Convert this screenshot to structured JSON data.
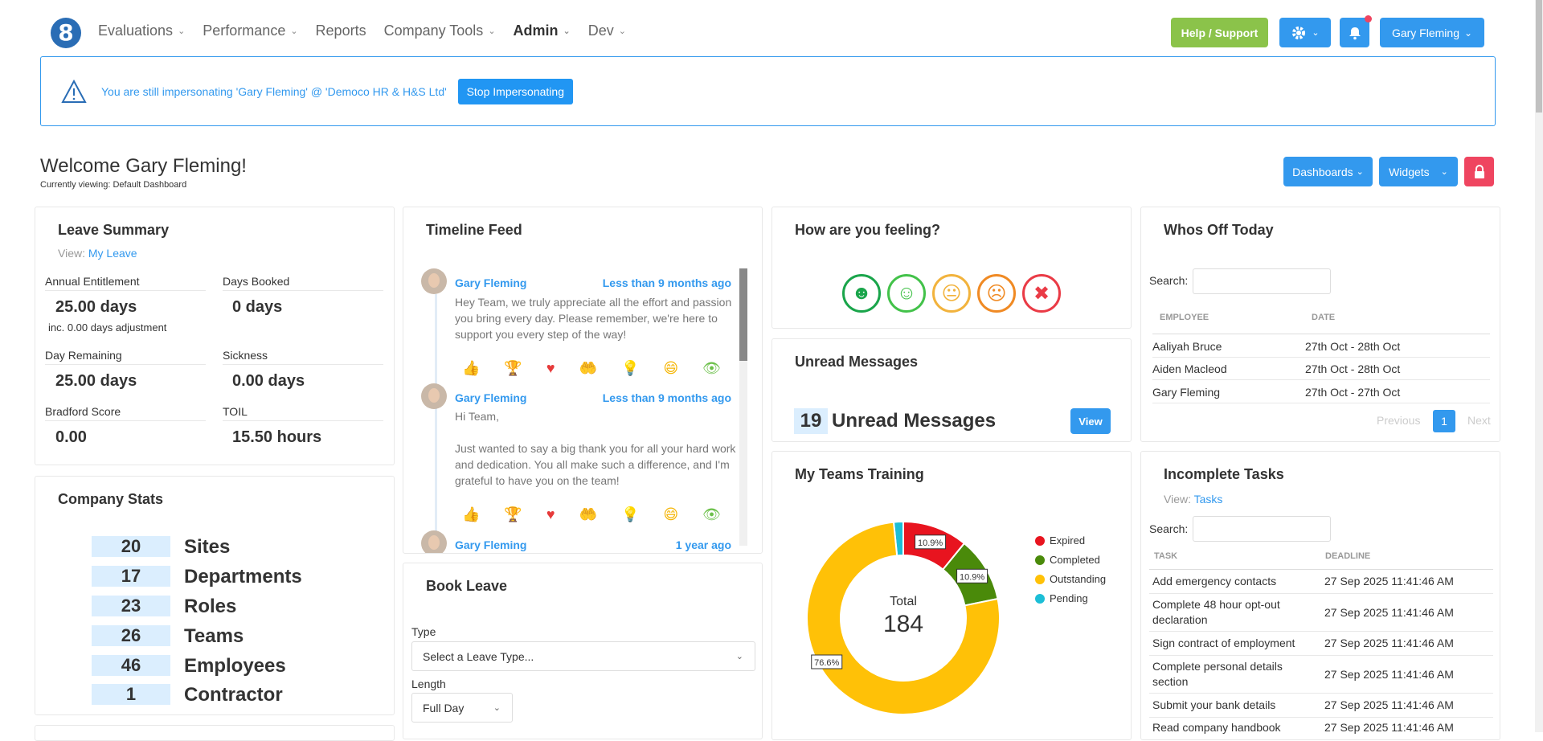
{
  "nav": {
    "logo": "8",
    "items": [
      {
        "label": "Evaluations",
        "dropdown": true
      },
      {
        "label": "Performance",
        "dropdown": true
      },
      {
        "label": "Reports",
        "dropdown": false
      },
      {
        "label": "Company Tools",
        "dropdown": true
      },
      {
        "label": "Admin",
        "dropdown": true
      },
      {
        "label": "Dev",
        "dropdown": true
      }
    ],
    "help_label": "Help / Support",
    "user_label": "Gary Fleming"
  },
  "alert": {
    "text": "You are still impersonating 'Gary Fleming' @ 'Democo HR & H&S Ltd'",
    "button": "Stop Impersonating"
  },
  "welcome": {
    "title": "Welcome Gary Fleming!",
    "subtitle": "Currently viewing: Default Dashboard",
    "dashboards_label": "Dashboards",
    "widgets_label": "Widgets"
  },
  "leave_summary": {
    "title": "Leave Summary",
    "view_prefix": "View:",
    "view_link": "My Leave",
    "annual_label": "Annual Entitlement",
    "annual_value": "25.00 days",
    "adjustment": "inc. 0.00 days adjustment",
    "booked_label": "Days Booked",
    "booked_value": "0 days",
    "remaining_label": "Day Remaining",
    "remaining_value": "25.00 days",
    "sickness_label": "Sickness",
    "sickness_value": "0.00 days",
    "bradford_label": "Bradford Score",
    "bradford_value": "0.00",
    "toil_label": "TOIL",
    "toil_value": "15.50 hours"
  },
  "company_stats": {
    "title": "Company Stats",
    "items": [
      {
        "value": "20",
        "label": "Sites"
      },
      {
        "value": "17",
        "label": "Departments"
      },
      {
        "value": "23",
        "label": "Roles"
      },
      {
        "value": "26",
        "label": "Teams"
      },
      {
        "value": "46",
        "label": "Employees"
      },
      {
        "value": "1",
        "label": "Contractor"
      }
    ]
  },
  "timeline": {
    "title": "Timeline Feed",
    "posts": [
      {
        "author": "Gary Fleming",
        "time": "Less than 9 months ago",
        "body": "Hey Team, we truly appreciate all the effort and passion you bring every day. Please remember, we're here to support you every step of the way!"
      },
      {
        "author": "Gary Fleming",
        "time": "Less than 9 months ago",
        "body_line1": "Hi Team,",
        "body_line2": "Just wanted to say a big thank you for all your hard work and dedication. You all make such a difference, and I'm grateful to have you on the team!"
      },
      {
        "author": "Gary Fleming",
        "time": "1 year ago"
      }
    ]
  },
  "feeling": {
    "title": "How are you feeling?"
  },
  "unread": {
    "title": "Unread Messages",
    "count": "19",
    "label": "Unread Messages",
    "view": "View"
  },
  "training": {
    "title": "My Teams Training",
    "total_label": "Total",
    "total_value": "184",
    "legend": [
      {
        "name": "Expired",
        "color": "#e8141f"
      },
      {
        "name": "Completed",
        "color": "#4a8a0a"
      },
      {
        "name": "Outstanding",
        "color": "#ffc107"
      },
      {
        "name": "Pending",
        "color": "#1cbed6"
      }
    ]
  },
  "chart_data": {
    "type": "pie",
    "categories": [
      "Expired",
      "Completed",
      "Outstanding",
      "Pending"
    ],
    "values": [
      10.9,
      10.9,
      76.6,
      1.6
    ],
    "colors": [
      "#e8141f",
      "#4a8a0a",
      "#ffc107",
      "#1cbed6"
    ],
    "data_labels": [
      "10.9%",
      "10.9%",
      "76.6%",
      ""
    ],
    "center_label": "Total",
    "center_value": "184",
    "legend_position": "right"
  },
  "whos_off": {
    "title": "Whos Off Today",
    "search_label": "Search:",
    "col_employee": "EMPLOYEE",
    "col_date": "DATE",
    "rows": [
      {
        "name": "Aaliyah Bruce",
        "date": "27th Oct - 28th Oct"
      },
      {
        "name": "Aiden Macleod",
        "date": "27th Oct - 28th Oct"
      },
      {
        "name": "Gary Fleming",
        "date": "27th Oct - 27th Oct"
      }
    ],
    "prev": "Previous",
    "page": "1",
    "next": "Next"
  },
  "tasks": {
    "title": "Incomplete Tasks",
    "view_prefix": "View:",
    "view_link": "Tasks",
    "search_label": "Search:",
    "col_task": "TASK",
    "col_deadline": "DEADLINE",
    "rows": [
      {
        "task": "Add emergency contacts",
        "deadline": "27 Sep 2025 11:41:46 AM"
      },
      {
        "task": "Complete 48 hour opt-out declaration",
        "deadline": "27 Sep 2025 11:41:46 AM"
      },
      {
        "task": "Sign contract of employment",
        "deadline": "27 Sep 2025 11:41:46 AM"
      },
      {
        "task": "Complete personal details section",
        "deadline": "27 Sep 2025 11:41:46 AM"
      },
      {
        "task": "Submit your bank details",
        "deadline": "27 Sep 2025 11:41:46 AM"
      },
      {
        "task": "Read company handbook",
        "deadline": "27 Sep 2025 11:41:46 AM"
      }
    ]
  },
  "book_leave": {
    "title": "Book Leave",
    "type_label": "Type",
    "type_placeholder": "Select a Leave Type...",
    "length_label": "Length",
    "length_value": "Full Day"
  }
}
